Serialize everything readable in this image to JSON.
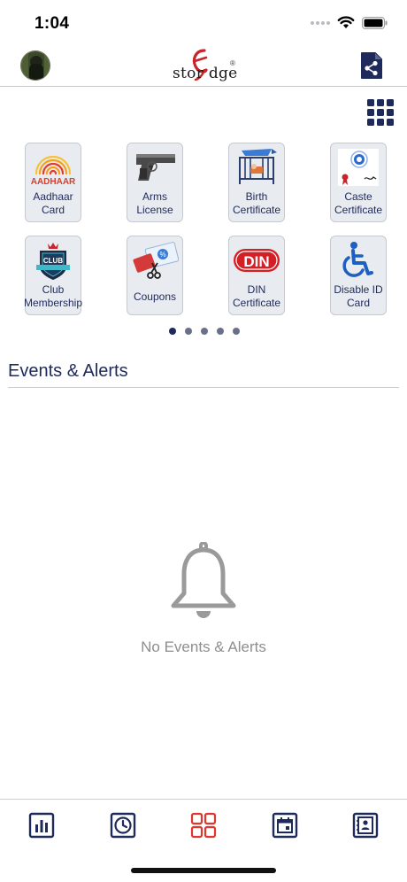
{
  "status": {
    "time": "1:04"
  },
  "header": {
    "avatar": "avatar",
    "logo_text": "stor  dge",
    "logo_mark": "e",
    "logo_reg": "®",
    "share_icon": "document-share-icon"
  },
  "toolbar": {
    "grid_icon": "grid-menu-icon"
  },
  "services": {
    "items": [
      {
        "label": "Aadhaar\nCard",
        "icon": "aadhaar-icon"
      },
      {
        "label": "Arms\nLicense",
        "icon": "pistol-icon"
      },
      {
        "label": "Birth\nCertificate",
        "icon": "crib-icon"
      },
      {
        "label": "Caste\nCertificate",
        "icon": "certificate-seal-icon"
      },
      {
        "label": "Club\nMembership",
        "icon": "club-badge-icon"
      },
      {
        "label": "Coupons",
        "icon": "coupon-scissors-icon"
      },
      {
        "label": "DIN\nCertificate",
        "icon": "din-icon"
      },
      {
        "label": "Disable ID\nCard",
        "icon": "wheelchair-icon"
      }
    ],
    "aadhaar_text": "AADHAAR",
    "club_text": "CLUB",
    "din_text": "DIN",
    "pages": 5,
    "active_page": 1
  },
  "events": {
    "title": "Events & Alerts",
    "empty_text": "No Events & Alerts"
  },
  "tabs": [
    {
      "icon": "bar-chart-icon"
    },
    {
      "icon": "clock-icon"
    },
    {
      "icon": "dashboard-grid-icon",
      "active": true
    },
    {
      "icon": "calendar-icon"
    },
    {
      "icon": "contacts-book-icon"
    }
  ],
  "colors": {
    "navy": "#1e2a5a",
    "active_tab": "#e0362e",
    "muted": "#8e8e8e",
    "tile_bg": "#e8ebf0"
  }
}
